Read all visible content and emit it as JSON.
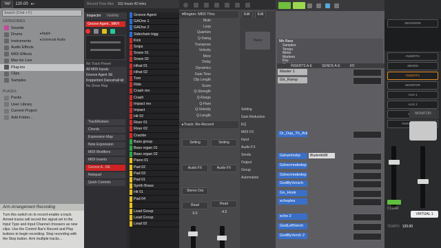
{
  "ableton": {
    "search_placeholder": "Search (Cmd + F)",
    "categories_heading": "CATEGORIES",
    "categories": [
      "Sounds",
      "Drums",
      "Instruments",
      "Audio Effects",
      "MIDI Effects",
      "Max for Live",
      "Plug-ins",
      "Clips",
      "Samples"
    ],
    "selected_category": "Plug-ins",
    "plugin_folders": [
      "Apple",
      "Universal Audio"
    ],
    "places_heading": "PLACES",
    "places": [
      "Packs",
      "User Library",
      "Current Project",
      "Add Folder..."
    ],
    "help_title": "Arm Arrangement Recording",
    "help_text": "Turn this switch on to record-enable a track. Armed tracks will record the signal set in the Input Type and Input Channel choosers as new clips. Use the Control Bar's Record and Play buttons to begin recording. Stop recording with the Stop button. Arm multiple tracks...",
    "top_values": [
      "TAP",
      "120.00"
    ]
  },
  "logic_lib": {
    "tabs": [
      "Inspector",
      "Visibility"
    ],
    "region_name": "Groove Agent...MKH",
    "input_labels": [
      "No Track Preset",
      "All MIDI Inputs",
      "Groove Agent SE",
      "Knppertont Dancehall kit",
      "No Show Map"
    ],
    "sections": [
      "TrackRestore",
      "Chords",
      "Expression Map",
      "Note Expression",
      "MIDI Modifiers",
      "MIDI Inserts",
      "Groove A...NE",
      "Notepad",
      "Quick Controls"
    ],
    "tracks": [
      {
        "n": "",
        "name": "Groove Agent",
        "color": "#2a6fd1"
      },
      {
        "n": "",
        "name": "GAOne 1",
        "color": "#2a6fd1"
      },
      {
        "n": "",
        "name": "GAOne 2",
        "color": "#2a6fd1"
      },
      {
        "n": "",
        "name": "Sidechain trigg",
        "color": "#2a6fd1"
      },
      {
        "n": "",
        "name": "Kick",
        "color": "#d12a2a"
      },
      {
        "n": "",
        "name": "Snips",
        "color": "#d12a2a"
      },
      {
        "n": "",
        "name": "Snare 01",
        "color": "#d12a2a"
      },
      {
        "n": "",
        "name": "Snare 02",
        "color": "#d12a2a"
      },
      {
        "n": "",
        "name": "Hihat 01",
        "color": "#d12a2a"
      },
      {
        "n": "",
        "name": "Hihat 02",
        "color": "#d12a2a"
      },
      {
        "n": "",
        "name": "Tom",
        "color": "#d12a2a"
      },
      {
        "n": "",
        "name": "Ride",
        "color": "#d12a2a"
      },
      {
        "n": "",
        "name": "Crash rev",
        "color": "#d12a2a"
      },
      {
        "n": "",
        "name": "Crash",
        "color": "#d12a2a"
      },
      {
        "n": "",
        "name": "Impact rev",
        "color": "#d12a2a"
      },
      {
        "n": "",
        "name": "Impact",
        "color": "#d12a2a"
      },
      {
        "n": "",
        "name": "Hit 02",
        "color": "#d12a2a"
      },
      {
        "n": "",
        "name": "Riser 01",
        "color": "#d12a2a"
      },
      {
        "n": "",
        "name": "Riser 02",
        "color": "#d12a2a"
      },
      {
        "n": "",
        "name": "Crackle",
        "color": "#d12a2a"
      },
      {
        "n": "",
        "name": "Bass group",
        "color": "#2fa84a"
      },
      {
        "n": "",
        "name": "Bass organ 01",
        "color": "#2fa84a"
      },
      {
        "n": "",
        "name": "Bass organ 02",
        "color": "#2fa84a"
      },
      {
        "n": "",
        "name": "Piano 01",
        "color": "#e6c21f"
      },
      {
        "n": "",
        "name": "Pad 02",
        "color": "#e6c21f"
      },
      {
        "n": "",
        "name": "Pad 03",
        "color": "#e6c21f"
      },
      {
        "n": "",
        "name": "Pad 01",
        "color": "#e6c21f"
      },
      {
        "n": "",
        "name": "Synth Brass",
        "color": "#e6c21f"
      },
      {
        "n": "",
        "name": "Hit 01",
        "color": "#e6c21f"
      },
      {
        "n": "",
        "name": "Pad 04",
        "color": "#e6c21f"
      },
      {
        "n": "",
        "name": "",
        "color": "#e6c21f"
      },
      {
        "n": "",
        "name": "Lead Group",
        "color": "#e6c21f"
      },
      {
        "n": "",
        "name": "Lead Group",
        "color": "#e6c21f"
      },
      {
        "n": "",
        "name": "Lead 02",
        "color": "#e6c21f"
      }
    ],
    "top_labels": [
      "Record Time Max",
      "511 hours 42 mins",
      "Record Format",
      "32-bit"
    ]
  },
  "logic_insp": {
    "region_title": "Region: MIDI Thru",
    "params": [
      "Mute",
      "Loop",
      "Quantize",
      "Q-Swing",
      "Transpose",
      "Velocity",
      "More",
      "Delay",
      "Dynamics",
      "Gate Time",
      "Clip Length",
      "Score",
      "Q-Strength",
      "Q-Range",
      "Q-Flam",
      "Q-Velocity",
      "Q-Length"
    ],
    "quantize_val": "off",
    "track_title": "Track: Re-Record",
    "edit_labels": [
      "Edit",
      "Edit"
    ],
    "strip_labels": [
      "Setting",
      "Gain Reduction",
      "EQ",
      "MIDI FX",
      "Input",
      "Audio FX",
      "Sends",
      "Output",
      "Group",
      "Automation"
    ],
    "audio_fx": [
      "Audio FX",
      "Audio FX"
    ],
    "stereo_out": "Stereo Out",
    "read": [
      "Read",
      "Read"
    ],
    "fader_vals": [
      "0.0",
      "-4.5"
    ],
    "rel": [
      "Rel"
    ],
    "inst": "Piano"
  },
  "protools": {
    "header": [
      "INSERTS A-E",
      "SENDS A-E",
      "I/O"
    ],
    "browser_items": [
      "Samples",
      "Tempo",
      "Meter",
      "Markers",
      "Key",
      "Chords"
    ],
    "browser_title": "Mix Bass",
    "tracks": [
      {
        "name": "Master 1",
        "color": "#b8b8b8",
        "text": "#111"
      },
      {
        "name": "Gtr_Ramp",
        "color": "#b8b8b8",
        "text": "#111"
      },
      {
        "name": "Dr_Dup_Th_Ark",
        "color": "#3a6fc9",
        "text": "#fff"
      },
      {
        "name": "GdrumIndrp",
        "color": "#3a6fc9",
        "text": "#fff"
      },
      {
        "name": "Gdrecmndedep",
        "color": "#3a6fc9",
        "text": "#fff"
      },
      {
        "name": "Gdrecmndedep",
        "color": "#3a6fc9",
        "text": "#fff"
      },
      {
        "name": "GodByVersch",
        "color": "#3a6fc9",
        "text": "#fff"
      },
      {
        "name": "Go_Hook",
        "color": "#3a6fc9",
        "text": "#fff"
      },
      {
        "name": "echoplex",
        "color": "#3a6fc9",
        "text": "#fff"
      },
      {
        "name": "echo 2",
        "color": "#3a6fc9",
        "text": "#fff"
      },
      {
        "name": "GodLeftVerch",
        "color": "#3a6fc9",
        "text": "#fff"
      },
      {
        "name": "GodByVerch 2",
        "color": "#3a6fc9",
        "text": "#fff"
      }
    ],
    "io_labels": [
      "A-MON LR",
      "Master 1",
      "Analog 1"
    ],
    "plugin": "Bluderbb88"
  },
  "ua": {
    "menu": [
      "SESSIONS",
      "INSERTS",
      "SENDS",
      "INSERTS",
      "MONITOR",
      "AUX 1",
      "AUX 2",
      "CUE 1",
      "PARAMETERS"
    ],
    "inserts_highlight": "INSERTS",
    "monitor_label": "MONITOR",
    "virtual": "VIRTUAL 1",
    "clear": "CLEAR",
    "tempo_label": "TEMPO",
    "tempo": "120.00"
  },
  "colors": {
    "ableton_bg": "#8f9092",
    "logic_red": "#d12a2a",
    "logic_blue": "#2a6fd1",
    "pt_blue": "#3a6fc9",
    "ua_orange": "#e88a1e",
    "ua_green": "#5fbe3c"
  }
}
